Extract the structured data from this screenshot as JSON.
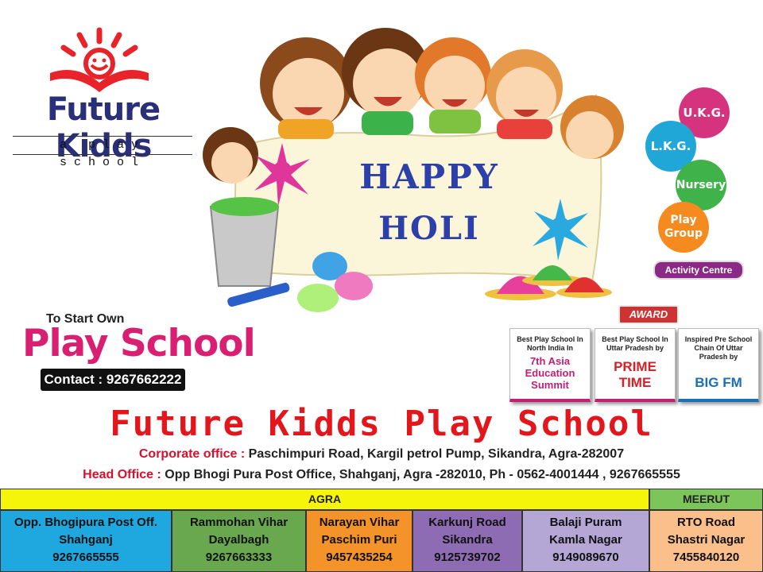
{
  "logo": {
    "name": "Future Kidds",
    "tagline": "a play school"
  },
  "greeting": {
    "line1": "HAPPY",
    "line2": "HOLI"
  },
  "classes": [
    {
      "label": "U.K.G.",
      "color": "#d6337f"
    },
    {
      "label": "L.K.G.",
      "color": "#20a7d8"
    },
    {
      "label": "Nursery",
      "color": "#3fb34a"
    },
    {
      "label": "Play Group",
      "color": "#f58a1f"
    }
  ],
  "activity_label": "Activity Centre",
  "promo": {
    "intro": "To Start Own",
    "title": "Play School",
    "contact": "Contact : 9267662222"
  },
  "awards": {
    "label": "AWARD",
    "items": [
      {
        "text": "Best Play School In North India In",
        "big": "7th Asia Education Summit"
      },
      {
        "text": "Best Play School In Uttar Pradesh by",
        "big": "PRIME TIME"
      },
      {
        "text": "Inspired Pre School Chain Of Uttar Pradesh by",
        "big": "BIG FM"
      }
    ]
  },
  "school_name": "Future Kidds Play School",
  "corporate": {
    "label": "Corporate office :",
    "address": " Paschimpuri Road, Kargil petrol Pump, Sikandra, Agra-282007"
  },
  "head": {
    "label": "Head Office :",
    "address": " Opp Bhogi Pura Post Office, Shahganj, Agra -282010, Ph - 0562-4001444 , 9267665555"
  },
  "regions": {
    "agra": "AGRA",
    "meerut": "MEERUT"
  },
  "branches": [
    {
      "line1": "Opp. Bhogipura Post Off.",
      "line2": "Shahganj",
      "phone": "9267665555",
      "color": "#1fa8e0"
    },
    {
      "line1": "Rammohan Vihar",
      "line2": "Dayalbagh",
      "phone": "9267663333",
      "color": "#6aa84f"
    },
    {
      "line1": "Narayan Vihar",
      "line2": "Paschim Puri",
      "phone": "9457435254",
      "color": "#f3932a"
    },
    {
      "line1": "Karkunj Road",
      "line2": "Sikandra",
      "phone": "9125739702",
      "color": "#8e6cb3"
    },
    {
      "line1": "Balaji Puram",
      "line2": "Kamla Nagar",
      "phone": "9149089670",
      "color": "#b4a7d6"
    },
    {
      "line1": "RTO Road",
      "line2": "Shastri Nagar",
      "phone": "7455840120",
      "color": "#fbbf8c"
    }
  ]
}
